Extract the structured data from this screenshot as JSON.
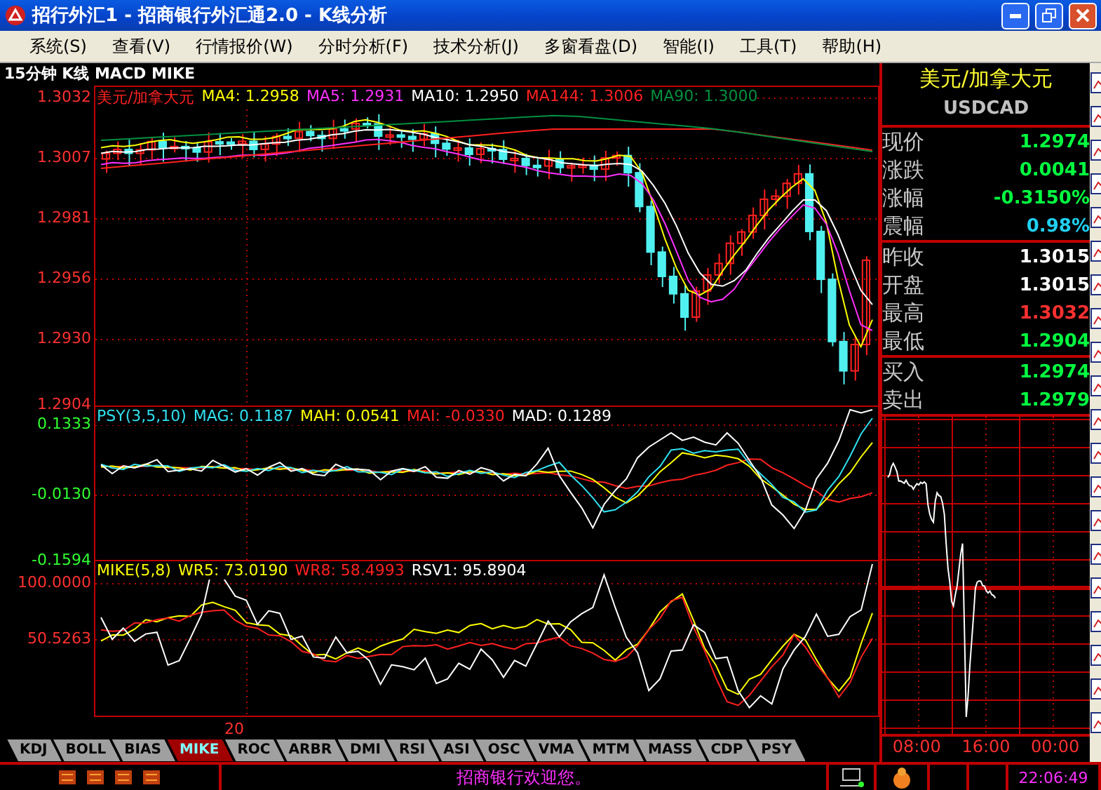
{
  "window": {
    "title": "招行外汇1 - 招商银行外汇通2.0 - K线分析"
  },
  "menu": [
    {
      "label": "系统(S)"
    },
    {
      "label": "查看(V)"
    },
    {
      "label": "行情报价(W)"
    },
    {
      "label": "分时分析(F)"
    },
    {
      "label": "技术分析(J)"
    },
    {
      "label": "多窗看盘(D)"
    },
    {
      "label": "智能(I)"
    },
    {
      "label": "工具(T)"
    },
    {
      "label": "帮助(H)"
    }
  ],
  "chart_header": "15分钟 K线 MACD MIKE",
  "panels": [
    {
      "legend": [
        {
          "text": "美元/加拿大元",
          "color": "#ff2020"
        },
        {
          "text": "MA4: 1.2958",
          "color": "#ffff00"
        },
        {
          "text": "MA5: 1.2931",
          "color": "#ff30ff"
        },
        {
          "text": "MA10: 1.2950",
          "color": "#ffffff"
        },
        {
          "text": "MA144: 1.3006",
          "color": "#ff2020"
        },
        {
          "text": "MA90: 1.3000",
          "color": "#009040"
        }
      ],
      "y_labels": [
        "1.3032",
        "1.3007",
        "1.2981",
        "1.2956",
        "1.2930",
        "1.2904"
      ]
    },
    {
      "legend": [
        {
          "text": "PSY(3,5,10)",
          "color": "#30e0f0"
        },
        {
          "text": "MAG: 0.1187",
          "color": "#30e0f0"
        },
        {
          "text": "MAH: 0.0541",
          "color": "#ffff00"
        },
        {
          "text": "MAI: -0.0330",
          "color": "#ff2020"
        },
        {
          "text": "MAD: 0.1289",
          "color": "#ffffff"
        }
      ],
      "y_labels": [
        "0.1333",
        "-0.0130",
        "-0.1594"
      ]
    },
    {
      "legend": [
        {
          "text": "MIKE(5,8)",
          "color": "#ffff00"
        },
        {
          "text": "WR5: 73.0190",
          "color": "#ffff00"
        },
        {
          "text": "WR8: 58.4993",
          "color": "#ff2020"
        },
        {
          "text": "RSV1: 95.8904",
          "color": "#ffffff"
        }
      ],
      "y_labels": [
        "100.0000",
        "50.5263"
      ]
    }
  ],
  "x_labels": [
    "20"
  ],
  "indicator_tabs": [
    {
      "label": "KDJ",
      "selected": false
    },
    {
      "label": "BOLL",
      "selected": false
    },
    {
      "label": "BIAS",
      "selected": false
    },
    {
      "label": "MIKE",
      "selected": true
    },
    {
      "label": "ROC",
      "selected": false
    },
    {
      "label": "ARBR",
      "selected": false
    },
    {
      "label": "DMI",
      "selected": false
    },
    {
      "label": "RSI",
      "selected": false
    },
    {
      "label": "ASI",
      "selected": false
    },
    {
      "label": "OSC",
      "selected": false
    },
    {
      "label": "VMA",
      "selected": false
    },
    {
      "label": "MTM",
      "selected": false
    },
    {
      "label": "MASS",
      "selected": false
    },
    {
      "label": "CDP",
      "selected": false
    },
    {
      "label": "PSY",
      "selected": false
    }
  ],
  "quote": {
    "name": "美元/加拿大元",
    "code": "USDCAD",
    "groups": [
      [
        {
          "label": "现价",
          "value": "1.2974",
          "color": "#00ff40"
        },
        {
          "label": "涨跌",
          "value": "0.0041",
          "color": "#00ff40"
        },
        {
          "label": "涨幅",
          "value": "-0.3150%",
          "color": "#00ff40"
        },
        {
          "label": "震幅",
          "value": "0.98%",
          "color": "#20d0f0"
        }
      ],
      [
        {
          "label": "昨收",
          "value": "1.3015",
          "color": "#ffffff"
        },
        {
          "label": "开盘",
          "value": "1.3015",
          "color": "#ffffff"
        },
        {
          "label": "最高",
          "value": "1.3032",
          "color": "#ff3030"
        },
        {
          "label": "最低",
          "value": "1.2904",
          "color": "#00ff40"
        }
      ],
      [
        {
          "label": "买入",
          "value": "1.2974",
          "color": "#00ff40"
        },
        {
          "label": "卖出",
          "value": "1.2979",
          "color": "#00ff40"
        }
      ]
    ]
  },
  "intraday": {
    "x_labels": [
      "08:00",
      "16:00",
      "00:00"
    ]
  },
  "status_bar": {
    "message": "招商银行欢迎您。",
    "time": "22:06:49"
  }
}
